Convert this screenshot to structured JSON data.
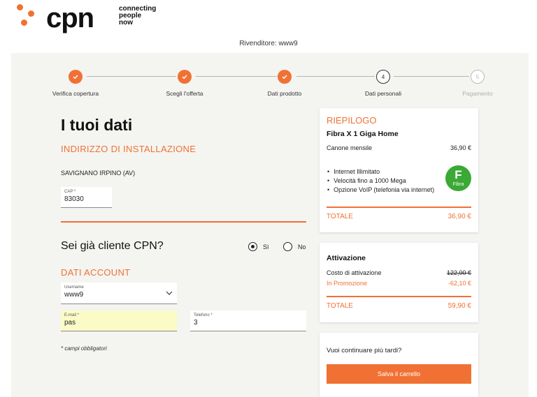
{
  "brand": {
    "logo_word": "cpn",
    "tagline": [
      "connecting",
      "people",
      "now"
    ],
    "accent": "#f07133"
  },
  "reseller": "Rivenditore: www9",
  "steps": [
    {
      "label": "Verifica copertura",
      "status": "done",
      "icon": "check-icon"
    },
    {
      "label": "Scegli l'offerta",
      "status": "done",
      "icon": "check-icon"
    },
    {
      "label": "Dati prodotto",
      "status": "done",
      "icon": "check-icon"
    },
    {
      "label": "Dati personali",
      "status": "current",
      "number": "4"
    },
    {
      "label": "Pagamento",
      "status": "todo",
      "number": "5"
    }
  ],
  "form": {
    "title": "I tuoi dati",
    "install_heading": "INDIRIZZO DI INSTALLAZIONE",
    "address": "SAVIGNANO IRPINO (AV)",
    "cap": {
      "label": "CAP *",
      "value": "83030"
    },
    "client_question": "Sei già cliente CPN?",
    "radio_yes": "Sì",
    "radio_no": "No",
    "radio_selected": "Sì",
    "account_heading": "DATI ACCOUNT",
    "username": {
      "label": "Username",
      "value": "www9"
    },
    "email": {
      "label": "E-mail *",
      "value": "pas"
    },
    "phone": {
      "label": "Telefono *",
      "value": "3"
    },
    "required_note": "* campi obbligatori"
  },
  "summary": {
    "title": "RIEPILOGO",
    "offer": "Fibra X 1 Giga Home",
    "monthly_label": "Canone mensile",
    "monthly_value": "36,90 €",
    "features": [
      "Internet Illimitato",
      "Velocità fino a 1000 Mega",
      "Opzione VoIP (telefonia via internet)"
    ],
    "badge_letter": "F",
    "badge_text": "Fibra",
    "total_label": "TOTALE",
    "total_value": "36,90 €"
  },
  "activation": {
    "title": "Attivazione",
    "cost_label": "Costo di attivazione",
    "cost_value": "122,00 €",
    "promo_label": "In Promozione",
    "promo_value": "-62,10 €",
    "total_label": "TOTALE",
    "total_value": "59,90 €"
  },
  "later": {
    "question": "Vuoi continuare più tardi?",
    "button": "Salva il carrello"
  }
}
